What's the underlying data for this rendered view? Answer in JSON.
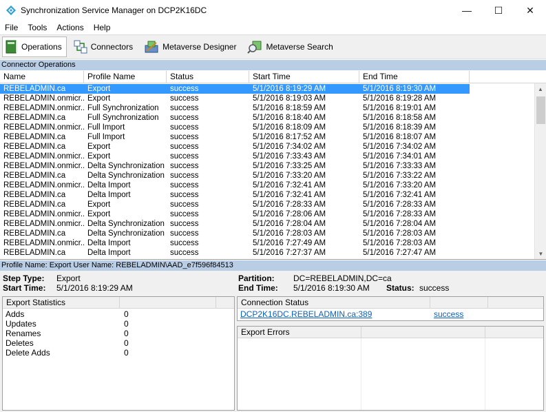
{
  "window": {
    "title": "Synchronization Service Manager on DCP2K16DC",
    "minimize": "—",
    "maximize": "☐",
    "close": "✕"
  },
  "menu": {
    "items": [
      "File",
      "Tools",
      "Actions",
      "Help"
    ]
  },
  "toolbar": {
    "operations": "Operations",
    "connectors": "Connectors",
    "metaverse_designer": "Metaverse Designer",
    "metaverse_search": "Metaverse Search"
  },
  "operations": {
    "section_title": "Connector Operations",
    "columns": [
      "Name",
      "Profile Name",
      "Status",
      "Start Time",
      "End Time"
    ],
    "selected_row": 0,
    "rows": [
      [
        "REBELADMIN.ca",
        "Export",
        "success",
        "5/1/2016 8:19:29 AM",
        "5/1/2016 8:19:30 AM"
      ],
      [
        "REBELADMIN.onmicr...",
        "Export",
        "success",
        "5/1/2016 8:19:03 AM",
        "5/1/2016 8:19:28 AM"
      ],
      [
        "REBELADMIN.onmicr...",
        "Full Synchronization",
        "success",
        "5/1/2016 8:18:59 AM",
        "5/1/2016 8:19:01 AM"
      ],
      [
        "REBELADMIN.ca",
        "Full Synchronization",
        "success",
        "5/1/2016 8:18:40 AM",
        "5/1/2016 8:18:58 AM"
      ],
      [
        "REBELADMIN.onmicr...",
        "Full Import",
        "success",
        "5/1/2016 8:18:09 AM",
        "5/1/2016 8:18:39 AM"
      ],
      [
        "REBELADMIN.ca",
        "Full Import",
        "success",
        "5/1/2016 8:17:52 AM",
        "5/1/2016 8:18:07 AM"
      ],
      [
        "REBELADMIN.ca",
        "Export",
        "success",
        "5/1/2016 7:34:02 AM",
        "5/1/2016 7:34:02 AM"
      ],
      [
        "REBELADMIN.onmicr...",
        "Export",
        "success",
        "5/1/2016 7:33:43 AM",
        "5/1/2016 7:34:01 AM"
      ],
      [
        "REBELADMIN.onmicr...",
        "Delta Synchronization",
        "success",
        "5/1/2016 7:33:25 AM",
        "5/1/2016 7:33:33 AM"
      ],
      [
        "REBELADMIN.ca",
        "Delta Synchronization",
        "success",
        "5/1/2016 7:33:20 AM",
        "5/1/2016 7:33:22 AM"
      ],
      [
        "REBELADMIN.onmicr...",
        "Delta Import",
        "success",
        "5/1/2016 7:32:41 AM",
        "5/1/2016 7:33:20 AM"
      ],
      [
        "REBELADMIN.ca",
        "Delta Import",
        "success",
        "5/1/2016 7:32:41 AM",
        "5/1/2016 7:32:41 AM"
      ],
      [
        "REBELADMIN.ca",
        "Export",
        "success",
        "5/1/2016 7:28:33 AM",
        "5/1/2016 7:28:33 AM"
      ],
      [
        "REBELADMIN.onmicr...",
        "Export",
        "success",
        "5/1/2016 7:28:06 AM",
        "5/1/2016 7:28:33 AM"
      ],
      [
        "REBELADMIN.onmicr...",
        "Delta Synchronization",
        "success",
        "5/1/2016 7:28:04 AM",
        "5/1/2016 7:28:04 AM"
      ],
      [
        "REBELADMIN.ca",
        "Delta Synchronization",
        "success",
        "5/1/2016 7:28:03 AM",
        "5/1/2016 7:28:03 AM"
      ],
      [
        "REBELADMIN.onmicr...",
        "Delta Import",
        "success",
        "5/1/2016 7:27:49 AM",
        "5/1/2016 7:28:03 AM"
      ],
      [
        "REBELADMIN.ca",
        "Delta Import",
        "success",
        "5/1/2016 7:27:37 AM",
        "5/1/2016 7:27:47 AM"
      ]
    ]
  },
  "details": {
    "header": "Profile Name: Export  User Name: REBELADMIN\\AAD_e7f596f84513",
    "step_type_label": "Step Type:",
    "step_type": "Export",
    "start_time_label": "Start Time:",
    "start_time": "5/1/2016 8:19:29 AM",
    "partition_label": "Partition:",
    "partition": "DC=REBELADMIN,DC=ca",
    "end_time_label": "End Time:",
    "end_time": "5/1/2016 8:19:30 AM",
    "status_label": "Status:",
    "status": "success",
    "export_statistics": {
      "title": "Export Statistics",
      "rows": [
        [
          "Adds",
          "0"
        ],
        [
          "Updates",
          "0"
        ],
        [
          "Renames",
          "0"
        ],
        [
          "Deletes",
          "0"
        ],
        [
          "Delete Adds",
          "0"
        ]
      ]
    },
    "connection_status": {
      "title": "Connection Status",
      "server": "DCP2K16DC.REBELADMIN.ca:389",
      "status": "success"
    },
    "export_errors": {
      "title": "Export Errors"
    }
  },
  "colors": {
    "section_header": "#b9cde5",
    "selection": "#3399ff",
    "link": "#0b5fbd"
  }
}
